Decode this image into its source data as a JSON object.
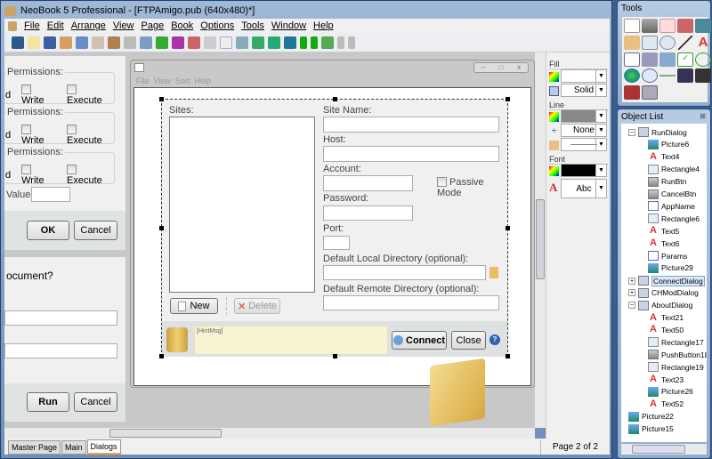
{
  "app": {
    "title": "NeoBook 5 Professional - [FTPAmigo.pub (640x480)*]"
  },
  "menu": [
    "File",
    "Edit",
    "Arrange",
    "View",
    "Page",
    "Book",
    "Options",
    "Tools",
    "Window",
    "Help"
  ],
  "left_dialogs": {
    "groups": [
      {
        "label": "Permissions:",
        "opt0": "d",
        "opt1": "Write",
        "opt2": "Execute"
      },
      {
        "label": "Permissions:",
        "opt0": "d",
        "opt1": "Write",
        "opt2": "Execute"
      },
      {
        "label": "Permissions:",
        "opt0": "d",
        "opt1": "Write",
        "opt2": "Execute"
      }
    ],
    "value_label": "Value:",
    "ok": "OK",
    "cancel": "Cancel",
    "question": "ocument?",
    "run": "Run",
    "cancel2": "Cancel"
  },
  "canvas": {
    "menu": [
      "File",
      "View",
      "Sort",
      "Help"
    ],
    "dialog": {
      "sites": "Sites:",
      "site_name": "Site Name:",
      "host": "Host:",
      "account": "Account:",
      "passive": "Passive Mode",
      "password": "Password:",
      "port": "Port:",
      "local_dir": "Default Local Directory (optional):",
      "remote_dir": "Default Remote Directory (optional):",
      "new": "New",
      "delete": "Delete",
      "hint": "[HintMsg]",
      "connect": "Connect",
      "close": "Close"
    }
  },
  "props": {
    "fill": "Fill",
    "fill_style": "Solid",
    "line": "Line",
    "line_style": "None",
    "font": "Font",
    "font_sample": "Abc",
    "fill_color": "#f0f0f0",
    "line_color": "#888888",
    "font_color": "#000000"
  },
  "tabs": [
    "Master Page",
    "Main",
    "Dialogs"
  ],
  "active_tab": "Dialogs",
  "status": {
    "page": "Page 2 of 2"
  },
  "tools": {
    "title": "Tools"
  },
  "object_list": {
    "title": "Object List",
    "items": [
      {
        "label": "RunDialog",
        "icon": "dialog",
        "level": 0,
        "toggle": "−"
      },
      {
        "label": "Picture6",
        "icon": "picture",
        "level": 1
      },
      {
        "label": "Text4",
        "icon": "text",
        "level": 1
      },
      {
        "label": "Rectangle4",
        "icon": "rect",
        "level": 1
      },
      {
        "label": "RunBtn",
        "icon": "button",
        "level": 1
      },
      {
        "label": "CancelBtn",
        "icon": "button",
        "level": 1
      },
      {
        "label": "AppName",
        "icon": "textentry",
        "level": 1
      },
      {
        "label": "Rectangle6",
        "icon": "rect",
        "level": 1
      },
      {
        "label": "Text5",
        "icon": "text",
        "level": 1
      },
      {
        "label": "Text6",
        "icon": "text",
        "level": 1
      },
      {
        "label": "Params",
        "icon": "textentry",
        "level": 1
      },
      {
        "label": "Picture29",
        "icon": "picture",
        "level": 1
      },
      {
        "label": "ConnectDialog",
        "icon": "dialog",
        "level": 0,
        "toggle": "+",
        "selected": true
      },
      {
        "label": "CHModDialog",
        "icon": "dialog",
        "level": 0,
        "toggle": "+"
      },
      {
        "label": "AboutDialog",
        "icon": "dialog",
        "level": 0,
        "toggle": "−"
      },
      {
        "label": "Text21",
        "icon": "text",
        "level": 1
      },
      {
        "label": "Text50",
        "icon": "text",
        "level": 1
      },
      {
        "label": "Rectangle17",
        "icon": "rect",
        "level": 1
      },
      {
        "label": "PushButton18",
        "icon": "button",
        "level": 1
      },
      {
        "label": "Rectangle19",
        "icon": "rect",
        "level": 1
      },
      {
        "label": "Text23",
        "icon": "text",
        "level": 1
      },
      {
        "label": "Picture26",
        "icon": "picture",
        "level": 1
      },
      {
        "label": "Text52",
        "icon": "text",
        "level": 1
      },
      {
        "label": "Picture22",
        "icon": "picture",
        "level": 0
      },
      {
        "label": "Picture15",
        "icon": "picture",
        "level": 0
      }
    ]
  }
}
